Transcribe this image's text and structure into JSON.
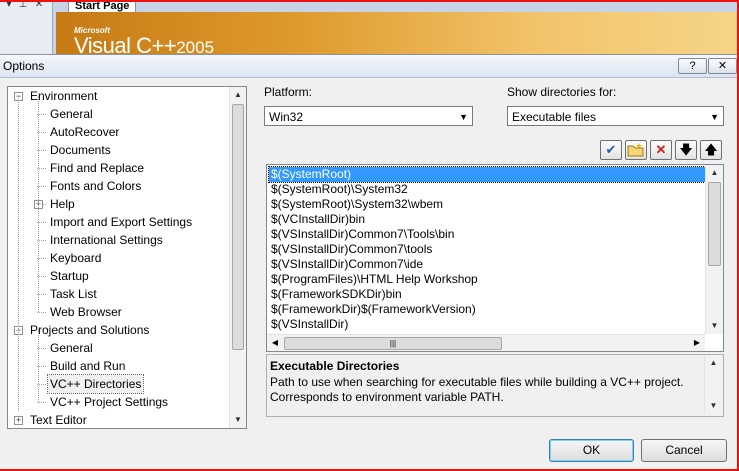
{
  "ide": {
    "start_page_tab": "Start Page",
    "banner_microsoft": "Microsoft",
    "banner_product": "Visual C++",
    "banner_year": "2005"
  },
  "dialog": {
    "title": "Options",
    "help_button": "?",
    "close_button": "X"
  },
  "tree": {
    "items": [
      {
        "label": "Environment",
        "level": 0,
        "expander": "−"
      },
      {
        "label": "General",
        "level": 1
      },
      {
        "label": "AutoRecover",
        "level": 1
      },
      {
        "label": "Documents",
        "level": 1
      },
      {
        "label": "Find and Replace",
        "level": 1
      },
      {
        "label": "Fonts and Colors",
        "level": 1
      },
      {
        "label": "Help",
        "level": 1,
        "expander": "+"
      },
      {
        "label": "Import and Export Settings",
        "level": 1
      },
      {
        "label": "International Settings",
        "level": 1
      },
      {
        "label": "Keyboard",
        "level": 1
      },
      {
        "label": "Startup",
        "level": 1
      },
      {
        "label": "Task List",
        "level": 1
      },
      {
        "label": "Web Browser",
        "level": 1
      },
      {
        "label": "Projects and Solutions",
        "level": 0,
        "expander": "−"
      },
      {
        "label": "General",
        "level": 1
      },
      {
        "label": "Build and Run",
        "level": 1
      },
      {
        "label": "VC++ Directories",
        "level": 1,
        "selected": true
      },
      {
        "label": "VC++ Project Settings",
        "level": 1
      },
      {
        "label": "Text Editor",
        "level": 0,
        "expander": "+"
      }
    ]
  },
  "platform": {
    "label": "Platform:",
    "value": "Win32"
  },
  "show_dirs": {
    "label": "Show directories for:",
    "value": "Executable files"
  },
  "toolbar": {
    "icons": [
      "checkmark-icon",
      "new-folder-icon",
      "delete-icon",
      "move-down-icon",
      "move-up-icon"
    ]
  },
  "directories": {
    "items": [
      "$(SystemRoot)",
      "$(SystemRoot)\\System32",
      "$(SystemRoot)\\System32\\wbem",
      "$(VCInstallDir)bin",
      "$(VSInstallDir)Common7\\Tools\\bin",
      "$(VSInstallDir)Common7\\tools",
      "$(VSInstallDir)Common7\\ide",
      "$(ProgramFiles)\\HTML Help Workshop",
      "$(FrameworkSDKDir)bin",
      "$(FrameworkDir)$(FrameworkVersion)",
      "$(VSInstallDir)"
    ],
    "selected_index": 0
  },
  "description": {
    "heading": "Executable Directories",
    "text": "Path to use when searching for executable files while building a VC++ project. Corresponds to environment variable PATH."
  },
  "buttons": {
    "ok": "OK",
    "cancel": "Cancel"
  },
  "colors": {
    "selection": "#3399ff",
    "banner": "#de9a2c",
    "annotation_border": "#e11111"
  }
}
